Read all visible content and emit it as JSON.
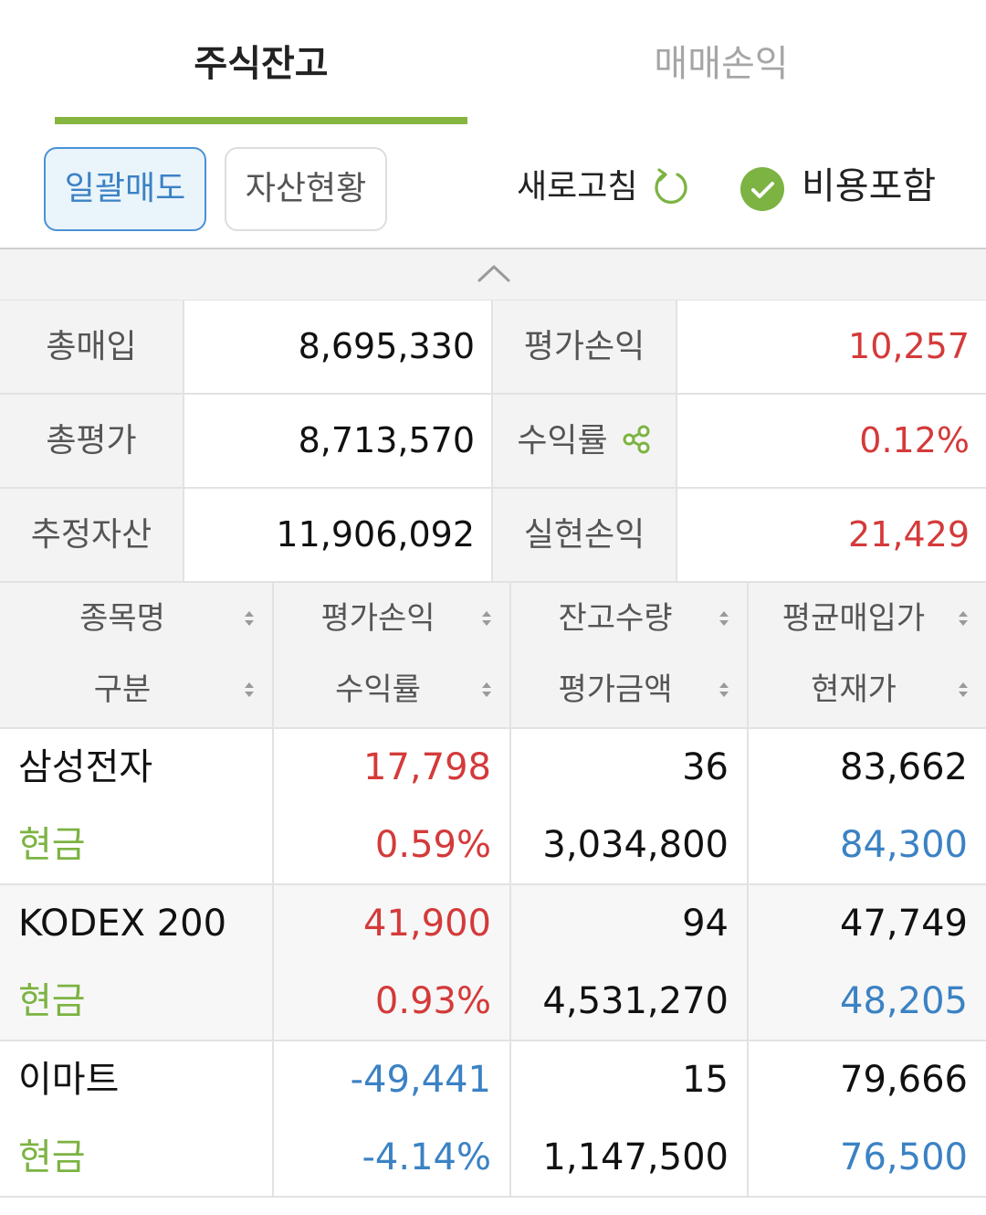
{
  "tabs": [
    {
      "label": "주식잔고",
      "active": true
    },
    {
      "label": "매매손익",
      "active": false
    }
  ],
  "toolbar": {
    "bulk_sell_label": "일괄매도",
    "asset_status_label": "자산현황",
    "refresh_label": "새로고침",
    "include_fees_label": "비용포함",
    "include_fees_checked": true
  },
  "summary": {
    "rows": [
      {
        "label1": "총매입",
        "value1": "8,695,330",
        "label2": "평가손익",
        "value2": "10,257"
      },
      {
        "label1": "총평가",
        "value1": "8,713,570",
        "label2": "수익률",
        "value2": "0.12%"
      },
      {
        "label1": "추정자산",
        "value1": "11,906,092",
        "label2": "실현손익",
        "value2": "21,429"
      }
    ]
  },
  "holdings_header": {
    "col1": {
      "top": "종목명",
      "bottom": "구분"
    },
    "col2": {
      "top": "평가손익",
      "bottom": "수익률"
    },
    "col3": {
      "top": "잔고수량",
      "bottom": "평가금액"
    },
    "col4": {
      "top": "평균매입가",
      "bottom": "현재가"
    }
  },
  "holdings": [
    {
      "name": "삼성전자",
      "type": "현금",
      "pl": "17,798",
      "rate": "0.59%",
      "qty": "36",
      "eval": "3,034,800",
      "avg_price": "83,662",
      "current_price": "84,300"
    },
    {
      "name": "KODEX 200",
      "type": "현금",
      "pl": "41,900",
      "rate": "0.93%",
      "qty": "94",
      "eval": "4,531,270",
      "avg_price": "47,749",
      "current_price": "48,205"
    },
    {
      "name": "이마트",
      "type": "현금",
      "pl": "-49,441",
      "rate": "-4.14%",
      "qty": "15",
      "eval": "1,147,500",
      "avg_price": "79,666",
      "current_price": "76,500"
    }
  ],
  "colors": {
    "accent_green": "#86b640",
    "cash_green": "#7cb342",
    "positive_red": "#d43a3a",
    "negative_blue": "#3b82c4"
  }
}
